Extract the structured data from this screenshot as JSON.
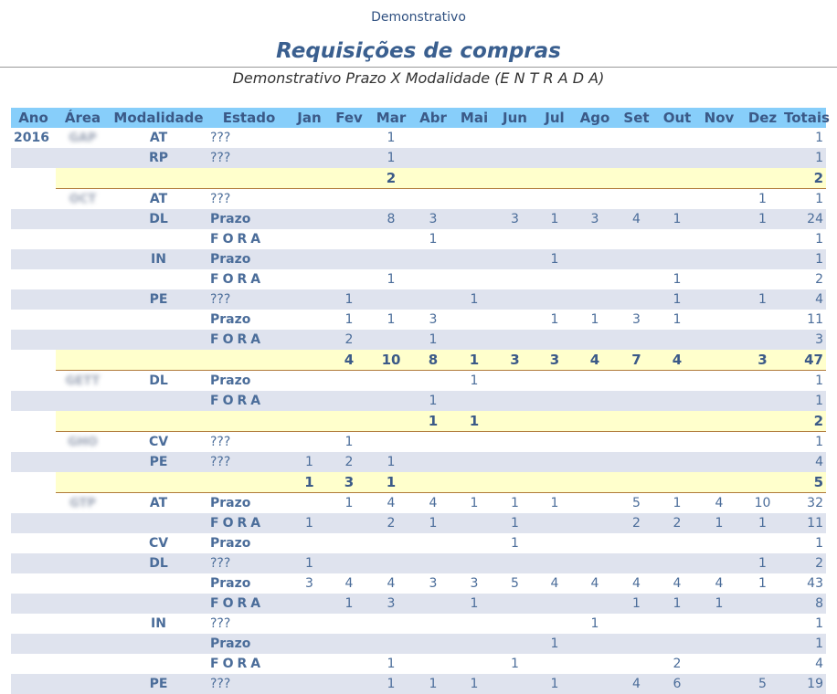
{
  "page": {
    "top_title": "Demonstrativo",
    "main_title": "Requisições de compras",
    "subtitle": "Demonstrativo Prazo X Modalidade (E N T R A D A)"
  },
  "table": {
    "headers": [
      "Ano",
      "Área",
      "Modalidade",
      "Estado",
      "Jan",
      "Fev",
      "Mar",
      "Abr",
      "Mai",
      "Jun",
      "Jul",
      "Ago",
      "Set",
      "Out",
      "Nov",
      "Dez",
      "Totais"
    ],
    "rows": [
      {
        "type": "data",
        "ano": "2016",
        "area": "GAP",
        "mod": "AT",
        "estado": "???",
        "kind": "unk",
        "m": [
          "",
          "",
          "1",
          "",
          "",
          "",
          "",
          "",
          "",
          "",
          "",
          ""
        ],
        "tot": "1"
      },
      {
        "type": "data",
        "ano": "",
        "area": "",
        "mod": "RP",
        "estado": "???",
        "kind": "unk",
        "m": [
          "",
          "",
          "1",
          "",
          "",
          "",
          "",
          "",
          "",
          "",
          "",
          ""
        ],
        "tot": "1"
      },
      {
        "type": "subtotal",
        "m": [
          "",
          "",
          "2",
          "",
          "",
          "",
          "",
          "",
          "",
          "",
          "",
          ""
        ],
        "tot": "2"
      },
      {
        "type": "data",
        "ano": "",
        "area": "OCT",
        "mod": "AT",
        "estado": "???",
        "kind": "unk",
        "m": [
          "",
          "",
          "",
          "",
          "",
          "",
          "",
          "",
          "",
          "",
          "",
          "1"
        ],
        "tot": "1"
      },
      {
        "type": "data",
        "ano": "",
        "area": "",
        "mod": "DL",
        "estado": "Prazo",
        "kind": "prazo",
        "m": [
          "",
          "",
          "8",
          "3",
          "",
          "3",
          "1",
          "3",
          "4",
          "1",
          "",
          "1"
        ],
        "tot": "24"
      },
      {
        "type": "data",
        "ano": "",
        "area": "",
        "mod": "",
        "estado": "FORA",
        "kind": "fora",
        "m": [
          "",
          "",
          "",
          "1",
          "",
          "",
          "",
          "",
          "",
          "",
          "",
          ""
        ],
        "tot": "1"
      },
      {
        "type": "data",
        "ano": "",
        "area": "",
        "mod": "IN",
        "estado": "Prazo",
        "kind": "prazo",
        "m": [
          "",
          "",
          "",
          "",
          "",
          "",
          "1",
          "",
          "",
          "",
          "",
          ""
        ],
        "tot": "1"
      },
      {
        "type": "data",
        "ano": "",
        "area": "",
        "mod": "",
        "estado": "FORA",
        "kind": "fora",
        "m": [
          "",
          "",
          "1",
          "",
          "",
          "",
          "",
          "",
          "",
          "1",
          "",
          ""
        ],
        "tot": "2"
      },
      {
        "type": "data",
        "ano": "",
        "area": "",
        "mod": "PE",
        "estado": "???",
        "kind": "unk",
        "m": [
          "",
          "1",
          "",
          "",
          "1",
          "",
          "",
          "",
          "",
          "1",
          "",
          "1"
        ],
        "tot": "4"
      },
      {
        "type": "data",
        "ano": "",
        "area": "",
        "mod": "",
        "estado": "Prazo",
        "kind": "prazo",
        "m": [
          "",
          "1",
          "1",
          "3",
          "",
          "",
          "1",
          "1",
          "3",
          "1",
          "",
          ""
        ],
        "tot": "11"
      },
      {
        "type": "data",
        "ano": "",
        "area": "",
        "mod": "",
        "estado": "FORA",
        "kind": "fora",
        "m": [
          "",
          "2",
          "",
          "1",
          "",
          "",
          "",
          "",
          "",
          "",
          "",
          ""
        ],
        "tot": "3"
      },
      {
        "type": "subtotal",
        "m": [
          "",
          "4",
          "10",
          "8",
          "1",
          "3",
          "3",
          "4",
          "7",
          "4",
          "",
          "3"
        ],
        "tot": "47"
      },
      {
        "type": "data",
        "ano": "",
        "area": "GETT",
        "mod": "DL",
        "estado": "Prazo",
        "kind": "prazo",
        "m": [
          "",
          "",
          "",
          "",
          "1",
          "",
          "",
          "",
          "",
          "",
          "",
          ""
        ],
        "tot": "1"
      },
      {
        "type": "data",
        "ano": "",
        "area": "",
        "mod": "",
        "estado": "FORA",
        "kind": "fora",
        "m": [
          "",
          "",
          "",
          "1",
          "",
          "",
          "",
          "",
          "",
          "",
          "",
          ""
        ],
        "tot": "1"
      },
      {
        "type": "subtotal",
        "m": [
          "",
          "",
          "",
          "1",
          "1",
          "",
          "",
          "",
          "",
          "",
          "",
          ""
        ],
        "tot": "2"
      },
      {
        "type": "data",
        "ano": "",
        "area": "GHO",
        "mod": "CV",
        "estado": "???",
        "kind": "unk",
        "m": [
          "",
          "1",
          "",
          "",
          "",
          "",
          "",
          "",
          "",
          "",
          "",
          ""
        ],
        "tot": "1"
      },
      {
        "type": "data",
        "ano": "",
        "area": "",
        "mod": "PE",
        "estado": "???",
        "kind": "unk",
        "m": [
          "1",
          "2",
          "1",
          "",
          "",
          "",
          "",
          "",
          "",
          "",
          "",
          ""
        ],
        "tot": "4"
      },
      {
        "type": "subtotal",
        "m": [
          "1",
          "3",
          "1",
          "",
          "",
          "",
          "",
          "",
          "",
          "",
          "",
          ""
        ],
        "tot": "5"
      },
      {
        "type": "data",
        "ano": "",
        "area": "GTP",
        "mod": "AT",
        "estado": "Prazo",
        "kind": "prazo",
        "m": [
          "",
          "1",
          "4",
          "4",
          "1",
          "1",
          "1",
          "",
          "5",
          "1",
          "4",
          "10"
        ],
        "tot": "32"
      },
      {
        "type": "data",
        "ano": "",
        "area": "",
        "mod": "",
        "estado": "FORA",
        "kind": "fora",
        "m": [
          "1",
          "",
          "2",
          "1",
          "",
          "1",
          "",
          "",
          "2",
          "2",
          "1",
          "1"
        ],
        "tot": "11"
      },
      {
        "type": "data",
        "ano": "",
        "area": "",
        "mod": "CV",
        "estado": "Prazo",
        "kind": "prazo",
        "m": [
          "",
          "",
          "",
          "",
          "",
          "1",
          "",
          "",
          "",
          "",
          "",
          ""
        ],
        "tot": "1"
      },
      {
        "type": "data",
        "ano": "",
        "area": "",
        "mod": "DL",
        "estado": "???",
        "kind": "unk",
        "m": [
          "1",
          "",
          "",
          "",
          "",
          "",
          "",
          "",
          "",
          "",
          "",
          "1"
        ],
        "tot": "2"
      },
      {
        "type": "data",
        "ano": "",
        "area": "",
        "mod": "",
        "estado": "Prazo",
        "kind": "prazo",
        "m": [
          "3",
          "4",
          "4",
          "3",
          "3",
          "5",
          "4",
          "4",
          "4",
          "4",
          "4",
          "1"
        ],
        "tot": "43"
      },
      {
        "type": "data",
        "ano": "",
        "area": "",
        "mod": "",
        "estado": "FORA",
        "kind": "fora",
        "m": [
          "",
          "1",
          "3",
          "",
          "1",
          "",
          "",
          "",
          "1",
          "1",
          "1",
          ""
        ],
        "tot": "8"
      },
      {
        "type": "data",
        "ano": "",
        "area": "",
        "mod": "IN",
        "estado": "???",
        "kind": "unk",
        "m": [
          "",
          "",
          "",
          "",
          "",
          "",
          "",
          "1",
          "",
          "",
          "",
          ""
        ],
        "tot": "1"
      },
      {
        "type": "data",
        "ano": "",
        "area": "",
        "mod": "",
        "estado": "Prazo",
        "kind": "prazo",
        "m": [
          "",
          "",
          "",
          "",
          "",
          "",
          "1",
          "",
          "",
          "",
          "",
          ""
        ],
        "tot": "1"
      },
      {
        "type": "data",
        "ano": "",
        "area": "",
        "mod": "",
        "estado": "FORA",
        "kind": "fora",
        "m": [
          "",
          "",
          "1",
          "",
          "",
          "1",
          "",
          "",
          "",
          "2",
          "",
          ""
        ],
        "tot": "4"
      },
      {
        "type": "data",
        "ano": "",
        "area": "",
        "mod": "PE",
        "estado": "???",
        "kind": "unk",
        "m": [
          "",
          "",
          "1",
          "1",
          "1",
          "",
          "1",
          "",
          "4",
          "6",
          "",
          "5"
        ],
        "tot": "19"
      }
    ]
  }
}
